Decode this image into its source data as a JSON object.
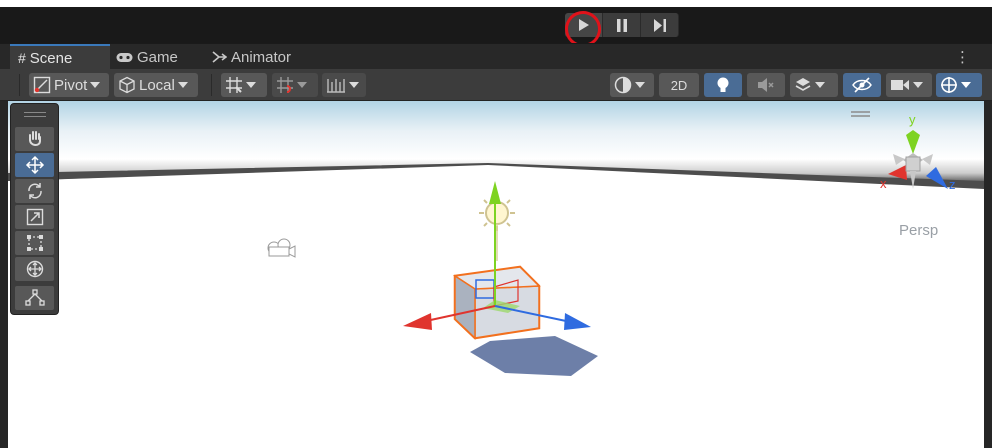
{
  "playbar": {
    "buttons": [
      {
        "name": "play",
        "icon": "play-icon"
      },
      {
        "name": "pause",
        "icon": "pause-icon"
      },
      {
        "name": "step",
        "icon": "step-forward-icon"
      }
    ]
  },
  "tabs": [
    {
      "label": "Scene",
      "icon": "grid-icon",
      "active": true
    },
    {
      "label": "Game",
      "icon": "gamepad-icon",
      "active": false
    },
    {
      "label": "Animator",
      "icon": "animator-icon",
      "active": false
    }
  ],
  "tab_menu": "⋮",
  "toolbar": {
    "pivot_label": "Pivot",
    "local_label": "Local",
    "mode_2d": "2D"
  },
  "tools": [
    {
      "name": "hand-tool",
      "icon": "hand-icon"
    },
    {
      "name": "move-tool",
      "icon": "move-icon",
      "selected": true
    },
    {
      "name": "rotate-tool",
      "icon": "rotate-icon"
    },
    {
      "name": "scale-tool",
      "icon": "scale-icon"
    },
    {
      "name": "rect-tool",
      "icon": "rect-icon"
    },
    {
      "name": "transform-tool",
      "icon": "transform-icon"
    },
    {
      "name": "custom-tool",
      "icon": "custom-editor-icon"
    }
  ],
  "gizmo": {
    "y": "y",
    "x": "x",
    "z": "z",
    "projection": "Persp"
  },
  "colors": {
    "accent": "#3a79bb",
    "selected_tool": "#4a6c95",
    "highlight": "#e0121a",
    "axis_x": "#e0342e",
    "axis_y": "#7ed321",
    "axis_z": "#2f6be0",
    "selection_outline": "#f2701e"
  }
}
